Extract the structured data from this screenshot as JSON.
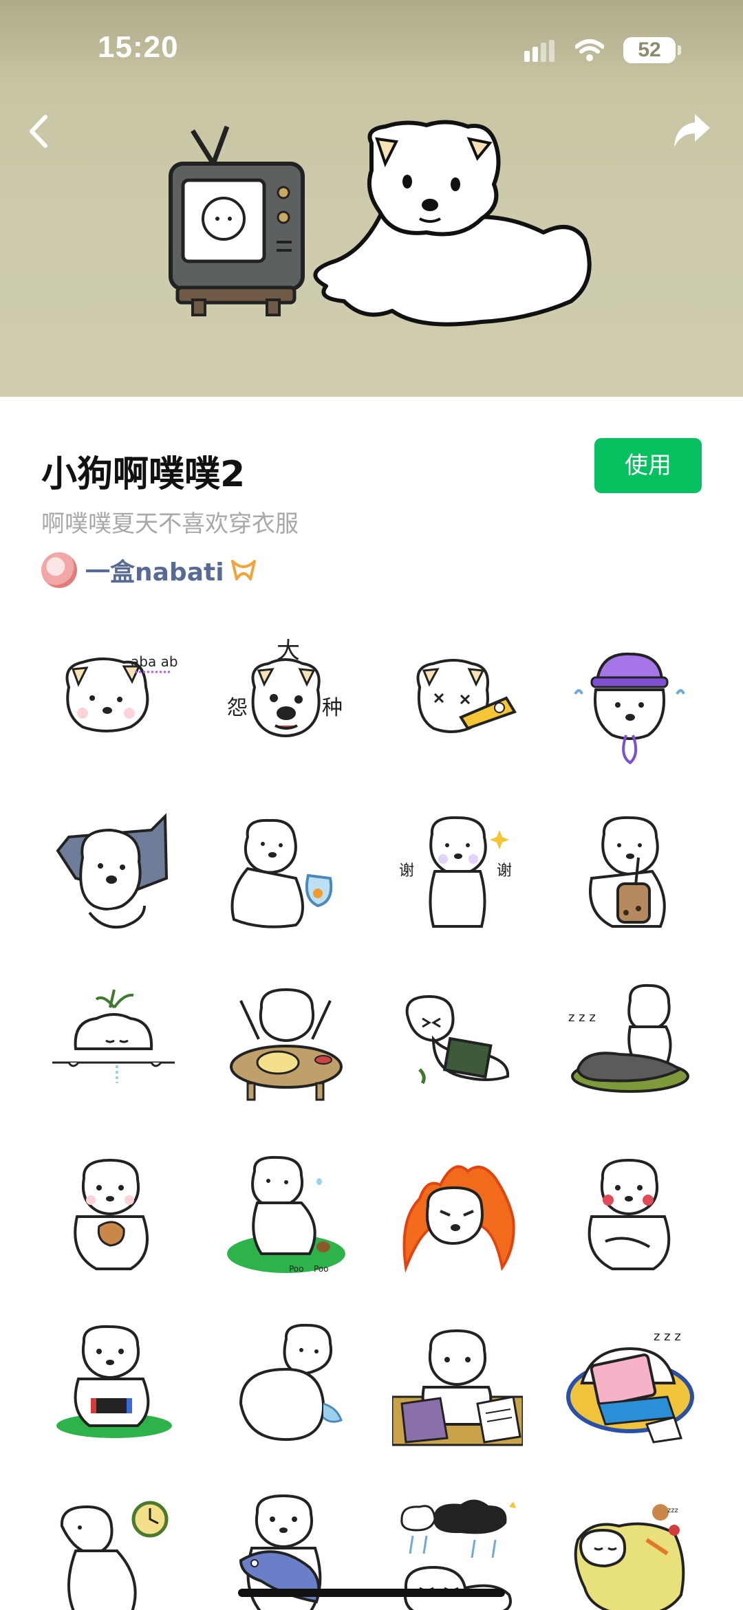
{
  "status_bar": {
    "time": "15:20",
    "battery": "52"
  },
  "header": {
    "back_icon": "chevron-left-icon",
    "share_icon": "share-arrow-icon"
  },
  "pack": {
    "title": "小狗啊噗噗2",
    "description": "啊噗噗夏天不喜欢穿衣服",
    "use_button": "使用",
    "author": "一盒nabati",
    "author_badge_icon": "ribbon-badge-icon"
  },
  "sticker_labels": {
    "s1": "aba aba",
    "s2a": "大",
    "s2b": "怨",
    "s2c": "种",
    "s7a": "谢",
    "s7b": "谢",
    "s18a": "Poo",
    "s18b": "Poo",
    "s24": "zzz"
  },
  "colors": {
    "accent": "#07c160",
    "author": "#576b95",
    "banner": "#cdcbac"
  }
}
